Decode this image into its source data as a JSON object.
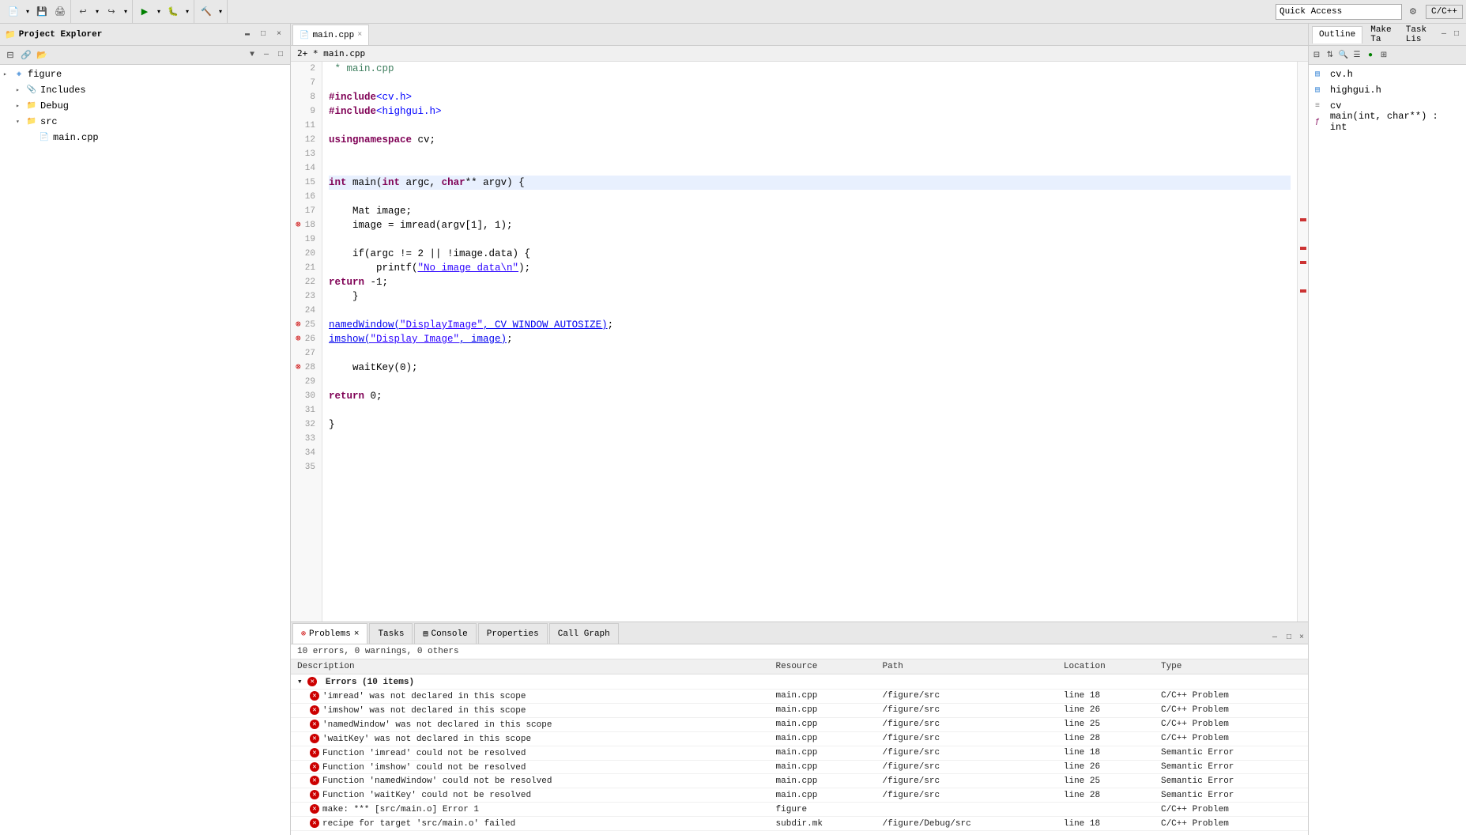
{
  "toolbar": {
    "quick_access_placeholder": "Quick Access",
    "cpp_label": "C/C++"
  },
  "project_explorer": {
    "title": "Project Explorer",
    "items": [
      {
        "id": "figure",
        "label": "figure",
        "level": 0,
        "type": "project",
        "expanded": true
      },
      {
        "id": "includes",
        "label": "Includes",
        "level": 1,
        "type": "folder",
        "expanded": false
      },
      {
        "id": "debug",
        "label": "Debug",
        "level": 1,
        "type": "folder",
        "expanded": false
      },
      {
        "id": "src",
        "label": "src",
        "level": 1,
        "type": "folder",
        "expanded": true
      },
      {
        "id": "main_cpp",
        "label": "main.cpp",
        "level": 2,
        "type": "file",
        "expanded": false
      }
    ]
  },
  "editor": {
    "tab_label": "main.cpp",
    "breadcrumb": "2+ * main.cpp",
    "lines": [
      {
        "num": 2,
        "content": " * main.cpp",
        "type": "comment",
        "error": false,
        "highlighted": false
      },
      {
        "num": 7,
        "content": "",
        "type": "normal",
        "error": false,
        "highlighted": false
      },
      {
        "num": 8,
        "content": "#include <cv.h>",
        "type": "include",
        "error": false,
        "highlighted": false
      },
      {
        "num": 9,
        "content": "#include <highgui.h>",
        "type": "include",
        "error": false,
        "highlighted": false
      },
      {
        "num": 11,
        "content": "",
        "type": "normal",
        "error": false,
        "highlighted": false
      },
      {
        "num": 12,
        "content": "using namespace cv;",
        "type": "normal",
        "error": false,
        "highlighted": false
      },
      {
        "num": 13,
        "content": "",
        "type": "normal",
        "error": false,
        "highlighted": false
      },
      {
        "num": 14,
        "content": "",
        "type": "normal",
        "error": false,
        "highlighted": false
      },
      {
        "num": 15,
        "content": "int main(int argc, char** argv) {",
        "type": "normal",
        "error": false,
        "highlighted": true
      },
      {
        "num": 16,
        "content": "",
        "type": "normal",
        "error": false,
        "highlighted": false
      },
      {
        "num": 17,
        "content": "    Mat image;",
        "type": "normal",
        "error": false,
        "highlighted": false
      },
      {
        "num": 18,
        "content": "    image = imread(argv[1], 1);",
        "type": "normal",
        "error": true,
        "highlighted": false
      },
      {
        "num": 19,
        "content": "",
        "type": "normal",
        "error": false,
        "highlighted": false
      },
      {
        "num": 20,
        "content": "    if(argc != 2 || !image.data) {",
        "type": "normal",
        "error": false,
        "highlighted": false
      },
      {
        "num": 21,
        "content": "        printf(\"No image data\\n\");",
        "type": "normal",
        "error": false,
        "highlighted": false
      },
      {
        "num": 22,
        "content": "        return -1;",
        "type": "normal",
        "error": false,
        "highlighted": false
      },
      {
        "num": 23,
        "content": "    }",
        "type": "normal",
        "error": false,
        "highlighted": false
      },
      {
        "num": 24,
        "content": "",
        "type": "normal",
        "error": false,
        "highlighted": false
      },
      {
        "num": 25,
        "content": "    namedWindow(\"DisplayImage\", CV_WINDOW_AUTOSIZE);",
        "type": "normal",
        "error": true,
        "highlighted": false
      },
      {
        "num": 26,
        "content": "    imshow(\"Display Image\", image);",
        "type": "normal",
        "error": true,
        "highlighted": false
      },
      {
        "num": 27,
        "content": "",
        "type": "normal",
        "error": false,
        "highlighted": false
      },
      {
        "num": 28,
        "content": "    waitKey(0);",
        "type": "normal",
        "error": true,
        "highlighted": false
      },
      {
        "num": 29,
        "content": "",
        "type": "normal",
        "error": false,
        "highlighted": false
      },
      {
        "num": 30,
        "content": "    return 0;",
        "type": "normal",
        "error": false,
        "highlighted": false
      },
      {
        "num": 31,
        "content": "",
        "type": "normal",
        "error": false,
        "highlighted": false
      },
      {
        "num": 32,
        "content": "}",
        "type": "normal",
        "error": false,
        "highlighted": false
      },
      {
        "num": 33,
        "content": "",
        "type": "normal",
        "error": false,
        "highlighted": false
      },
      {
        "num": 34,
        "content": "",
        "type": "normal",
        "error": false,
        "highlighted": false
      },
      {
        "num": 35,
        "content": "",
        "type": "normal",
        "error": false,
        "highlighted": false
      }
    ]
  },
  "outline": {
    "title": "Outline",
    "tabs": [
      "Outline",
      "Make Ta",
      "Task Lis"
    ],
    "items": [
      {
        "label": "cv.h",
        "type": "header"
      },
      {
        "label": "highgui.h",
        "type": "header"
      },
      {
        "label": "cv",
        "type": "namespace"
      },
      {
        "label": "main(int, char**) : int",
        "type": "function"
      }
    ]
  },
  "problems": {
    "tabs": [
      "Problems",
      "Tasks",
      "Console",
      "Properties",
      "Call Graph"
    ],
    "active_tab": "Problems",
    "status": "10 errors, 0 warnings, 0 others",
    "columns": [
      "Description",
      "Resource",
      "Path",
      "Location",
      "Type"
    ],
    "error_group": "Errors (10 items)",
    "errors": [
      {
        "desc": "'imread' was not declared in this scope",
        "resource": "main.cpp",
        "path": "/figure/src",
        "location": "line 18",
        "type": "C/C++ Problem"
      },
      {
        "desc": "'imshow' was not declared in this scope",
        "resource": "main.cpp",
        "path": "/figure/src",
        "location": "line 26",
        "type": "C/C++ Problem"
      },
      {
        "desc": "'namedWindow' was not declared in this scope",
        "resource": "main.cpp",
        "path": "/figure/src",
        "location": "line 25",
        "type": "C/C++ Problem"
      },
      {
        "desc": "'waitKey' was not declared in this scope",
        "resource": "main.cpp",
        "path": "/figure/src",
        "location": "line 28",
        "type": "C/C++ Problem"
      },
      {
        "desc": "Function 'imread' could not be resolved",
        "resource": "main.cpp",
        "path": "/figure/src",
        "location": "line 18",
        "type": "Semantic Error"
      },
      {
        "desc": "Function 'imshow' could not be resolved",
        "resource": "main.cpp",
        "path": "/figure/src",
        "location": "line 26",
        "type": "Semantic Error"
      },
      {
        "desc": "Function 'namedWindow' could not be resolved",
        "resource": "main.cpp",
        "path": "/figure/src",
        "location": "line 25",
        "type": "Semantic Error"
      },
      {
        "desc": "Function 'waitKey' could not be resolved",
        "resource": "main.cpp",
        "path": "/figure/src",
        "location": "line 28",
        "type": "Semantic Error"
      },
      {
        "desc": "make: *** [src/main.o] Error 1",
        "resource": "figure",
        "path": "",
        "location": "",
        "type": "C/C++ Problem"
      },
      {
        "desc": "recipe for target 'src/main.o' failed",
        "resource": "subdir.mk",
        "path": "/figure/Debug/src",
        "location": "line 18",
        "type": "C/C++ Problem"
      }
    ]
  }
}
